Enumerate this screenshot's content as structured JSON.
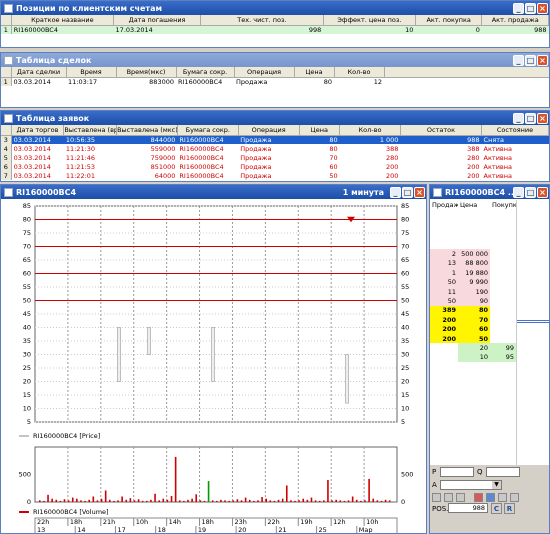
{
  "positions": {
    "title": "Позиции по клиентским счетам",
    "columns": [
      "Краткое название",
      "Дата погашения",
      "Тех. чист. поз.",
      "Эффект. цена поз.",
      "Акт. покупка",
      "Акт. продажа"
    ],
    "rows": [
      {
        "idx": "1",
        "cells": [
          "RI160000BC4",
          "17.03.2014",
          "998",
          "10",
          "0",
          "988"
        ]
      }
    ]
  },
  "trades": {
    "title": "Таблица сделок",
    "columns": [
      "Дата сделки",
      "Время",
      "Время(мкс)",
      "Бумага сокр.",
      "Операция",
      "Цена",
      "Кол-во"
    ],
    "rows": [
      {
        "idx": "1",
        "cells": [
          "03.03.2014",
          "11:03:17",
          "883000",
          "RI160000BC4",
          "Продажа",
          "80",
          "12"
        ]
      }
    ]
  },
  "orders": {
    "title": "Таблица заявок",
    "columns": [
      "Дата торгов",
      "Выставлена (вр",
      "Выставлена (мкс)",
      "Бумага сокр.",
      "Операция",
      "Цена",
      "Кол-во",
      "Остаток",
      "Состояние"
    ],
    "rows": [
      {
        "idx": "3",
        "style": "sel",
        "cells": [
          "03.03.2014",
          "10:56:35",
          "844000",
          "RI160000BC4",
          "Продажа",
          "80",
          "1 000",
          "988",
          "Снята"
        ]
      },
      {
        "idx": "4",
        "style": "red",
        "cells": [
          "03.03.2014",
          "11:21:30",
          "559000",
          "RI160000BC4",
          "Продажа",
          "80",
          "388",
          "388",
          "Активна"
        ]
      },
      {
        "idx": "5",
        "style": "red",
        "cells": [
          "03.03.2014",
          "11:21:46",
          "759000",
          "RI160000BC4",
          "Продажа",
          "70",
          "280",
          "280",
          "Активна"
        ]
      },
      {
        "idx": "6",
        "style": "red",
        "cells": [
          "03.03.2014",
          "11:21:53",
          "851000",
          "RI160000BC4",
          "Продажа",
          "60",
          "200",
          "200",
          "Активна"
        ]
      },
      {
        "idx": "7",
        "style": "red",
        "cells": [
          "03.03.2014",
          "11:22:01",
          "64000",
          "RI160000BC4",
          "Продажа",
          "50",
          "200",
          "200",
          "Активна"
        ]
      }
    ]
  },
  "chart_window": {
    "title": "RI160000BC4",
    "interval": "1 минута",
    "price_legend": "RI160000BC4 [Price]",
    "volume_legend": "RI160000BC4 [Volume]",
    "accent_red": "#d00000",
    "accent_green": "#009900"
  },
  "chart_data": [
    {
      "type": "line",
      "title": "",
      "ylim": [
        5,
        85
      ],
      "y_ticks": [
        5,
        10,
        15,
        20,
        25,
        30,
        35,
        40,
        45,
        50,
        55,
        60,
        65,
        70,
        75,
        80,
        85
      ],
      "horizontal_levels": [
        80,
        70,
        60,
        50
      ],
      "series": [
        {
          "name": "RI160000BC4 [Price]",
          "candles": [
            {
              "x": "14h",
              "low": 20,
              "high": 40
            },
            {
              "x": "14h",
              "low": 30,
              "high": 40
            },
            {
              "x": "21h",
              "low": 20,
              "high": 40
            },
            {
              "x": "10h",
              "low": 12,
              "high": 30
            }
          ]
        }
      ],
      "grid": true
    },
    {
      "type": "bar",
      "ylim": [
        0,
        1000
      ],
      "y_ticks": [
        0,
        500
      ],
      "series": [
        {
          "name": "RI160000BC4 [Volume]",
          "values": [
            30,
            20,
            130,
            60,
            40,
            20,
            50,
            30,
            80,
            60,
            30,
            20,
            40,
            100,
            30,
            60,
            210,
            40,
            20,
            30,
            100,
            40,
            70,
            30,
            50,
            20,
            20,
            40,
            150,
            30,
            60,
            40,
            110,
            820,
            30,
            20,
            40,
            60,
            140,
            30,
            20,
            380,
            30,
            20,
            40,
            30,
            20,
            30,
            50,
            30,
            80,
            40,
            20,
            30,
            90,
            60,
            30,
            20,
            40,
            60,
            300,
            30,
            20,
            30,
            60,
            40,
            80,
            30,
            20,
            30,
            400,
            30,
            40,
            30,
            20,
            30,
            100,
            40,
            20,
            30,
            420,
            60,
            30,
            20,
            40,
            30
          ]
        }
      ],
      "x_ticks_top": [
        "22h",
        "18h",
        "21h",
        "10h",
        "14h",
        "18h",
        "23h",
        "22h",
        "19h",
        "12h",
        "10h"
      ],
      "x_ticks_bottom": [
        "13",
        "14",
        "17",
        "18",
        "19",
        "20",
        "21",
        "25",
        "Мар"
      ]
    }
  ],
  "orderbook": {
    "title": "RI160000BC4 ...",
    "columns": [
      "Продаж",
      "Цена",
      "Покупк"
    ],
    "rows": [
      {
        "type": "sell",
        "qty": "2",
        "price": "500 000",
        "buy": ""
      },
      {
        "type": "sell",
        "qty": "13",
        "price": "88 800",
        "buy": ""
      },
      {
        "type": "sell",
        "qty": "1",
        "price": "19 880",
        "buy": ""
      },
      {
        "type": "sell",
        "qty": "50",
        "price": "9 990",
        "buy": ""
      },
      {
        "type": "sell",
        "qty": "11",
        "price": "190",
        "buy": ""
      },
      {
        "type": "sell",
        "qty": "50",
        "price": "90",
        "buy": ""
      },
      {
        "type": "best",
        "qty": "389",
        "price": "80",
        "buy": ""
      },
      {
        "type": "best",
        "qty": "200",
        "price": "70",
        "buy": ""
      },
      {
        "type": "best",
        "qty": "200",
        "price": "60",
        "buy": ""
      },
      {
        "type": "best",
        "qty": "200",
        "price": "50",
        "buy": ""
      },
      {
        "type": "buy",
        "qty": "",
        "price": "20",
        "buy": "99"
      },
      {
        "type": "buy",
        "qty": "",
        "price": "10",
        "buy": "95"
      }
    ],
    "p_label": "P",
    "q_label": "Q",
    "a_label": "A",
    "pos_label": "POS.",
    "pos_value": "988",
    "c_label": "C",
    "r_label": "R"
  }
}
